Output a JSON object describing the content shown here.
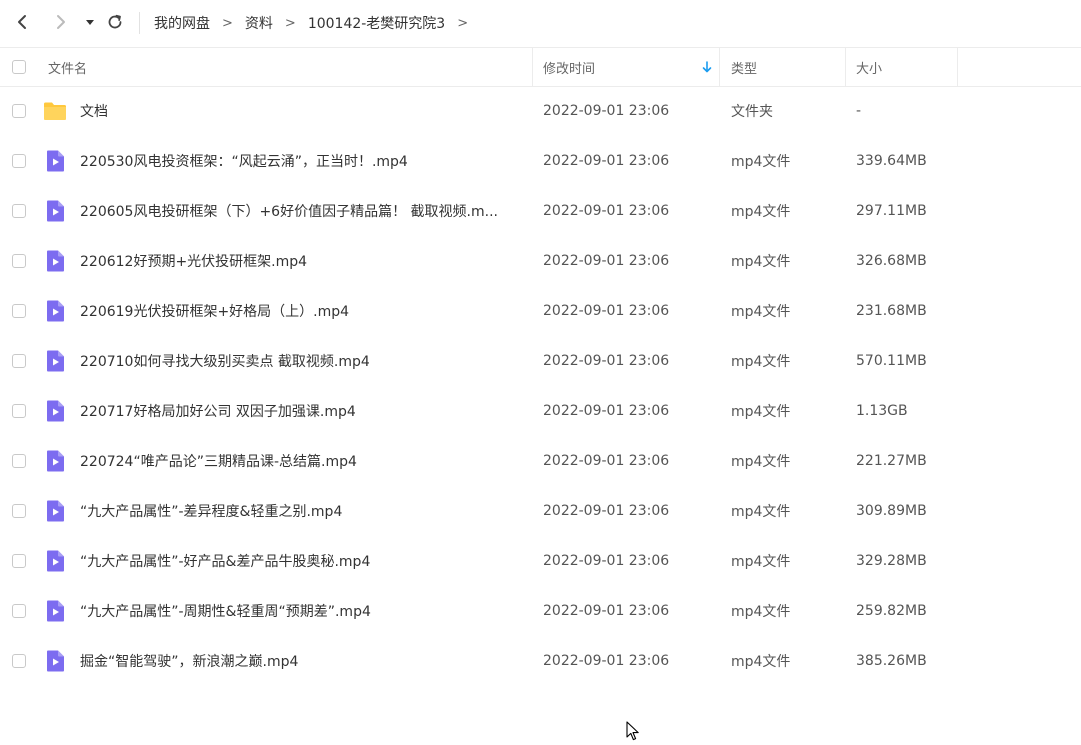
{
  "breadcrumb": {
    "items": [
      "我的网盘",
      "资料",
      "100142-老樊研究院3"
    ],
    "separator": ">"
  },
  "header": {
    "name": "文件名",
    "modified": "修改时间",
    "type": "类型",
    "size": "大小",
    "sort_column": "modified",
    "sort_direction": "descending"
  },
  "colors": {
    "accent": "#1a9cf0",
    "folder": "#ffc83d",
    "video_icon": "#7c6cf0"
  },
  "files": [
    {
      "icon": "folder-icon",
      "name": "文档",
      "modified": "2022-09-01 23:06",
      "type": "文件夹",
      "size": "-"
    },
    {
      "icon": "video-file-icon",
      "name": "220530风电投资框架：“风起云涌”，正当时！.mp4",
      "modified": "2022-09-01 23:06",
      "type": "mp4文件",
      "size": "339.64MB"
    },
    {
      "icon": "video-file-icon",
      "name": "220605风电投研框架（下）+6好价值因子精品篇！ 截取视频.m...",
      "modified": "2022-09-01 23:06",
      "type": "mp4文件",
      "size": "297.11MB"
    },
    {
      "icon": "video-file-icon",
      "name": "220612好预期+光伏投研框架.mp4",
      "modified": "2022-09-01 23:06",
      "type": "mp4文件",
      "size": "326.68MB"
    },
    {
      "icon": "video-file-icon",
      "name": "220619光伏投研框架+好格局（上）.mp4",
      "modified": "2022-09-01 23:06",
      "type": "mp4文件",
      "size": "231.68MB"
    },
    {
      "icon": "video-file-icon",
      "name": "220710如何寻找大级别买卖点 截取视频.mp4",
      "modified": "2022-09-01 23:06",
      "type": "mp4文件",
      "size": "570.11MB"
    },
    {
      "icon": "video-file-icon",
      "name": "220717好格局加好公司  双因子加强课.mp4",
      "modified": "2022-09-01 23:06",
      "type": "mp4文件",
      "size": "1.13GB"
    },
    {
      "icon": "video-file-icon",
      "name": "220724“唯产品论”三期精品课-总结篇.mp4",
      "modified": "2022-09-01 23:06",
      "type": "mp4文件",
      "size": "221.27MB"
    },
    {
      "icon": "video-file-icon",
      "name": "“九大产品属性”-差异程度&轻重之别.mp4",
      "modified": "2022-09-01 23:06",
      "type": "mp4文件",
      "size": "309.89MB"
    },
    {
      "icon": "video-file-icon",
      "name": "“九大产品属性”-好产品&差产品牛股奥秘.mp4",
      "modified": "2022-09-01 23:06",
      "type": "mp4文件",
      "size": "329.28MB"
    },
    {
      "icon": "video-file-icon",
      "name": "“九大产品属性”-周期性&轻重周“预期差”.mp4",
      "modified": "2022-09-01 23:06",
      "type": "mp4文件",
      "size": "259.82MB"
    },
    {
      "icon": "video-file-icon",
      "name": "掘金“智能驾驶”，新浪潮之巅.mp4",
      "modified": "2022-09-01 23:06",
      "type": "mp4文件",
      "size": "385.26MB"
    }
  ]
}
